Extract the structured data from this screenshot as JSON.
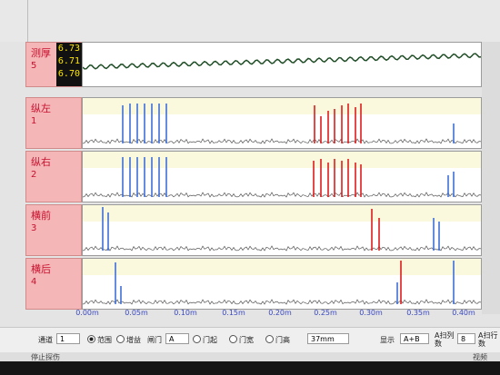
{
  "thickness": {
    "name": "测厚",
    "index": "5",
    "values": [
      "6.73",
      "6.71",
      "6.70"
    ]
  },
  "channels": [
    {
      "name": "纵左",
      "index": "1"
    },
    {
      "name": "纵右",
      "index": "2"
    },
    {
      "name": "横前",
      "index": "3"
    },
    {
      "name": "横后",
      "index": "4"
    }
  ],
  "axis": {
    "ticks": [
      "0.00m",
      "0.05m",
      "0.10m",
      "0.15m",
      "0.20m",
      "0.25m",
      "0.30m",
      "0.35m",
      "0.40m"
    ]
  },
  "toolbar": {
    "channel_label": "通道",
    "channel_value": "1",
    "mode_range": "范围",
    "mode_gain": "增益",
    "gate_label": "闸门",
    "gate_value": "A",
    "gate_start": "门起",
    "gate_width": "门宽",
    "gate_height": "门高",
    "value_field": "37mm",
    "display_label": "显示",
    "display_value": "A+B",
    "a_scan_column": "A扫列数",
    "column_value": "8",
    "a_scan_row": "A扫行数"
  },
  "status": {
    "left": "停止探伤",
    "right": "视频"
  },
  "colors": {
    "label_bg": "#f4b6b6",
    "label_text": "#c8102e",
    "blue": "#3f6fd8",
    "red": "#e01b1b"
  }
}
